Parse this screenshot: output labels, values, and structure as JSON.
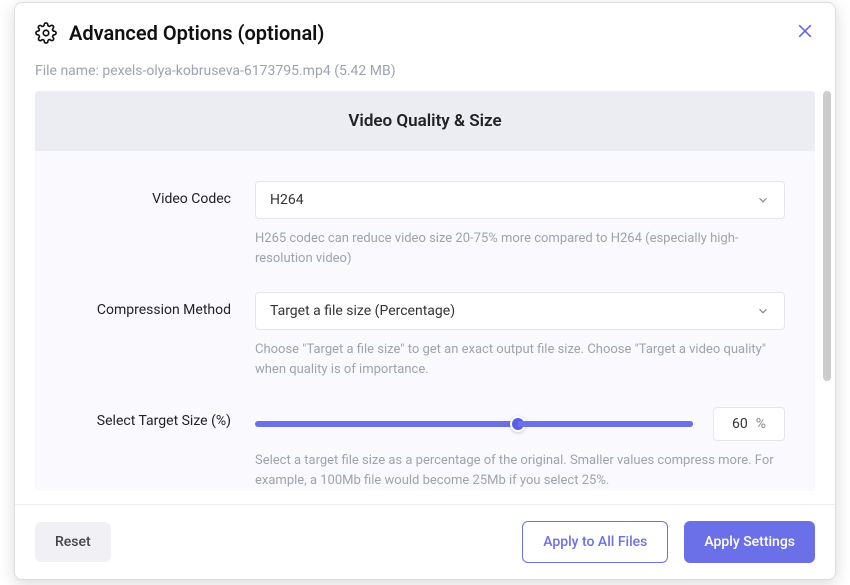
{
  "header": {
    "title": "Advanced Options (optional)"
  },
  "file": {
    "label": "File name:",
    "name": "pexels-olya-kobruseva-6173795.mp4",
    "size": "(5.42 MB)"
  },
  "section": {
    "title": "Video Quality & Size"
  },
  "codec": {
    "label": "Video Codec",
    "value": "H264",
    "hint": "H265 codec can reduce video size 20-75% more compared to H264 (especially high-resolution video)"
  },
  "method": {
    "label": "Compression Method",
    "value": "Target a file size (Percentage)",
    "hint": "Choose \"Target a file size\" to get an exact output file size. Choose \"Target a video quality\" when quality is of importance."
  },
  "target": {
    "label": "Select Target Size (%)",
    "value": "60",
    "unit": "%",
    "hint": "Select a target file size as a percentage of the original. Smaller values compress more. For example, a 100Mb file would become 25Mb if you select 25%."
  },
  "footer": {
    "reset": "Reset",
    "applyAll": "Apply to All Files",
    "apply": "Apply Settings"
  }
}
